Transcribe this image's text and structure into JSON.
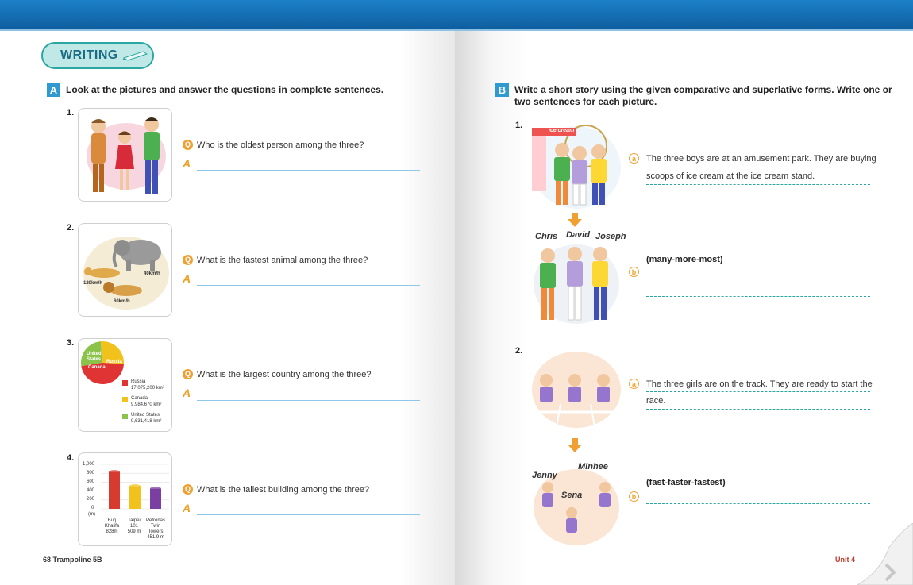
{
  "header": {
    "badge": "WRITING"
  },
  "section_a": {
    "letter": "A",
    "instruction": "Look at the pictures and answer the questions in complete sentences.",
    "q_icon": "Q",
    "a_icon": "A",
    "items": [
      {
        "number": "1.",
        "question": "Who is the oldest person among the three?"
      },
      {
        "number": "2.",
        "question": "What is the fastest animal among the three?",
        "labels": [
          "40km/h",
          "120km/h",
          "60km/h"
        ]
      },
      {
        "number": "3.",
        "question": "What is the largest country among the three?"
      },
      {
        "number": "4.",
        "question": "What is the tallest building among the three?"
      }
    ]
  },
  "chart_data": [
    {
      "type": "pie",
      "slice_labels": [
        "United States",
        "Canada",
        "Russia"
      ],
      "legend": [
        {
          "name": "Russia",
          "value": "17,075,200 km²",
          "color": "#e03434"
        },
        {
          "name": "Canada",
          "value": "9,984,670 km²",
          "color": "#f2c21c"
        },
        {
          "name": "United States",
          "value": "9,631,418 km²",
          "color": "#8bc34a"
        }
      ],
      "values": [
        9631418,
        9984670,
        17075200
      ]
    },
    {
      "type": "bar",
      "ylabel": "(m)",
      "yticks": [
        "1,000",
        "800",
        "600",
        "400",
        "200",
        "0"
      ],
      "ylim": [
        0,
        1000
      ],
      "categories": [
        {
          "name": "Burj Khalifa",
          "height_label": "828m"
        },
        {
          "name": "Taipei 101",
          "height_label": "509 m"
        },
        {
          "name": "Petronas Twin Towers",
          "height_label": "451.9 m"
        }
      ],
      "values": [
        828,
        509,
        451.9
      ],
      "colors": [
        "#d73a2e",
        "#f2c21c",
        "#7a3fa0"
      ]
    }
  ],
  "section_b": {
    "letter": "B",
    "instruction_line1": "Write a short story using the given comparative and superlative forms. Write one or",
    "instruction_line2": "two sentences for each picture.",
    "a_icon": "a",
    "b_icon": "b",
    "items": [
      {
        "number": "1.",
        "sign": "ice cream",
        "a_line1": "The three boys are at an amusement park. They are buying",
        "a_line2": "scoops of ice cream at the ice cream stand.",
        "names": [
          "Chris",
          "David",
          "Joseph"
        ],
        "hint": "(many-more-most)"
      },
      {
        "number": "2.",
        "a_line1": "The three girls are on the track. They are ready to start the",
        "a_line2": "race.",
        "names": [
          "Jenny",
          "Minhee",
          "Sena"
        ],
        "hint": "(fast-faster-fastest)"
      }
    ]
  },
  "footer": {
    "left": "68 Trampoline 5B",
    "right": "Unit 4"
  }
}
